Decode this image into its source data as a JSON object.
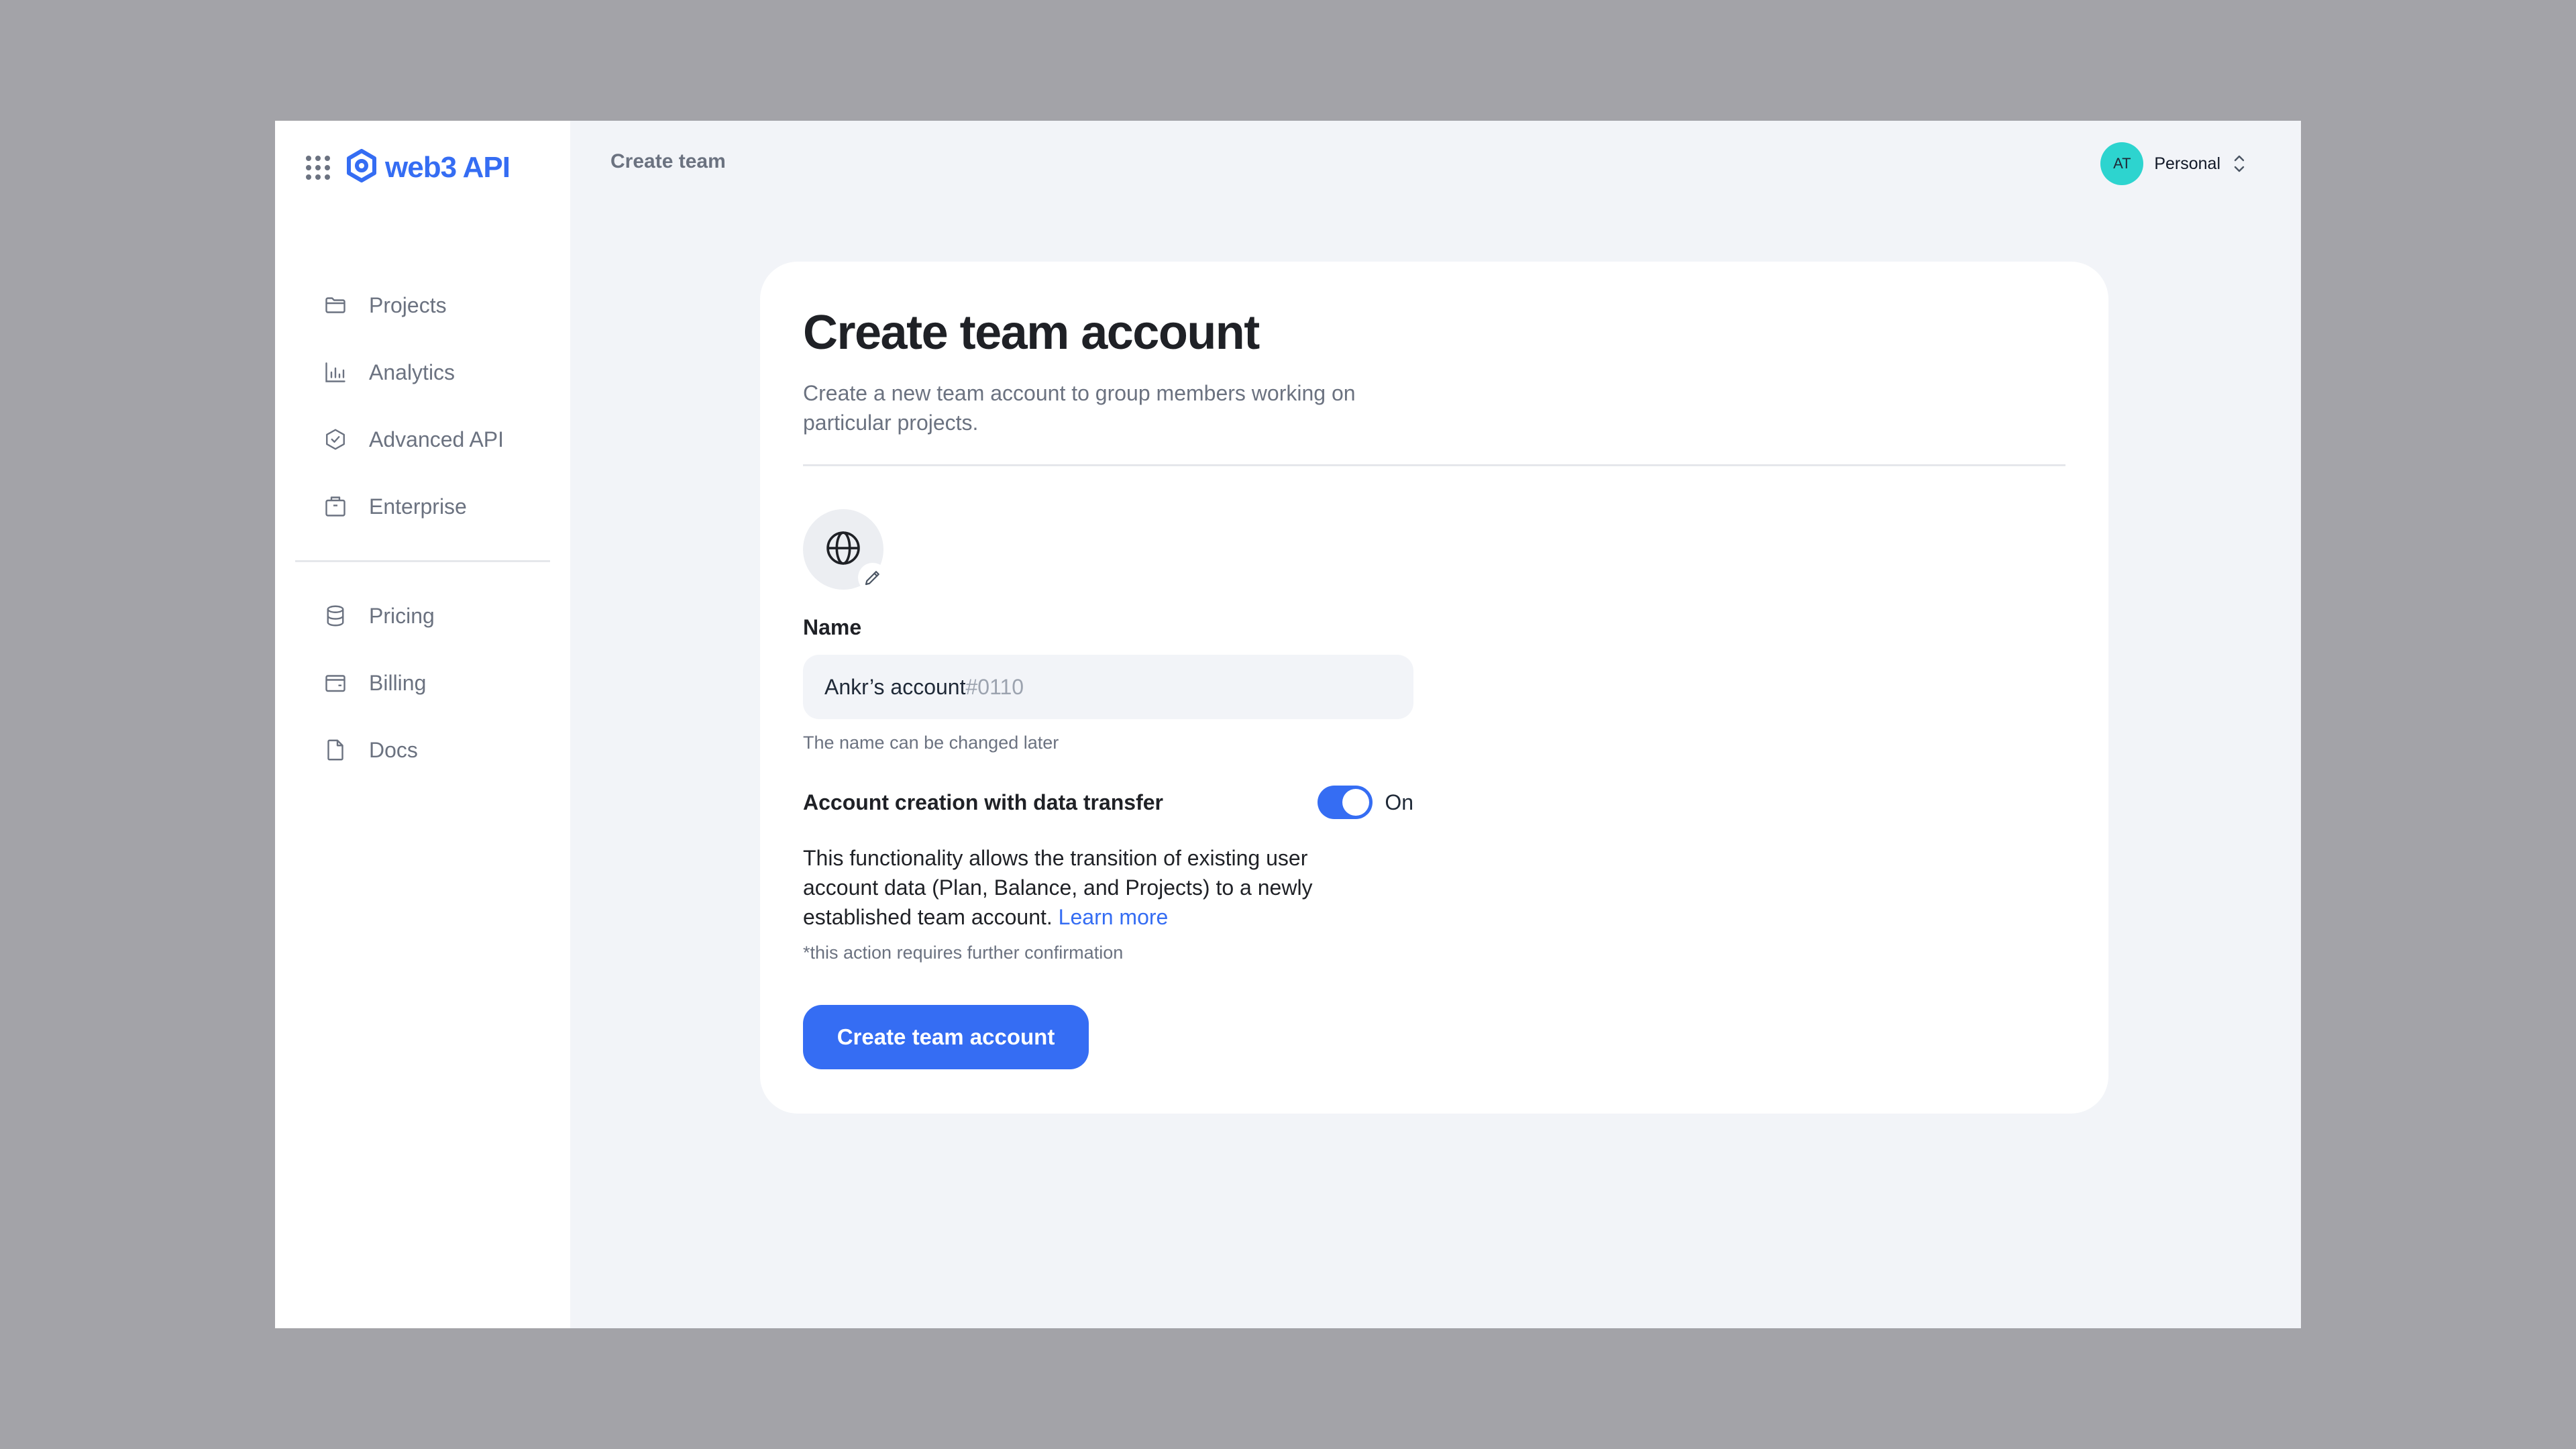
{
  "app": {
    "brand": "web3 API"
  },
  "sidebar": {
    "items": [
      {
        "label": "Projects",
        "icon": "folder-icon"
      },
      {
        "label": "Analytics",
        "icon": "bar-chart-icon"
      },
      {
        "label": "Advanced API",
        "icon": "advanced-api-icon"
      },
      {
        "label": "Enterprise",
        "icon": "briefcase-icon"
      }
    ],
    "secondary_items": [
      {
        "label": "Pricing",
        "icon": "database-icon"
      },
      {
        "label": "Billing",
        "icon": "wallet-icon"
      },
      {
        "label": "Docs",
        "icon": "document-icon"
      }
    ]
  },
  "header": {
    "title": "Create team",
    "account": {
      "initials": "AT",
      "label": "Personal"
    }
  },
  "form": {
    "title": "Create team account",
    "subtitle": "Create a new team account to group members working on particular projects.",
    "name_label": "Name",
    "name_value": "Ankr’s account",
    "name_suffix": "#0110",
    "name_hint": "The name can be changed later",
    "toggle_label": "Account creation with data transfer",
    "toggle_state": "On",
    "description": "This functionality allows the transition of existing user account data (Plan, Balance, and Projects) to a newly established team account.",
    "learn_more": "Learn more",
    "note": "*this action requires further confirmation",
    "submit_label": "Create team account"
  },
  "colors": {
    "accent": "#356df3",
    "avatar": "#2dd4cf",
    "background": "#f2f4f8",
    "backdrop": "#a3a3a8"
  }
}
